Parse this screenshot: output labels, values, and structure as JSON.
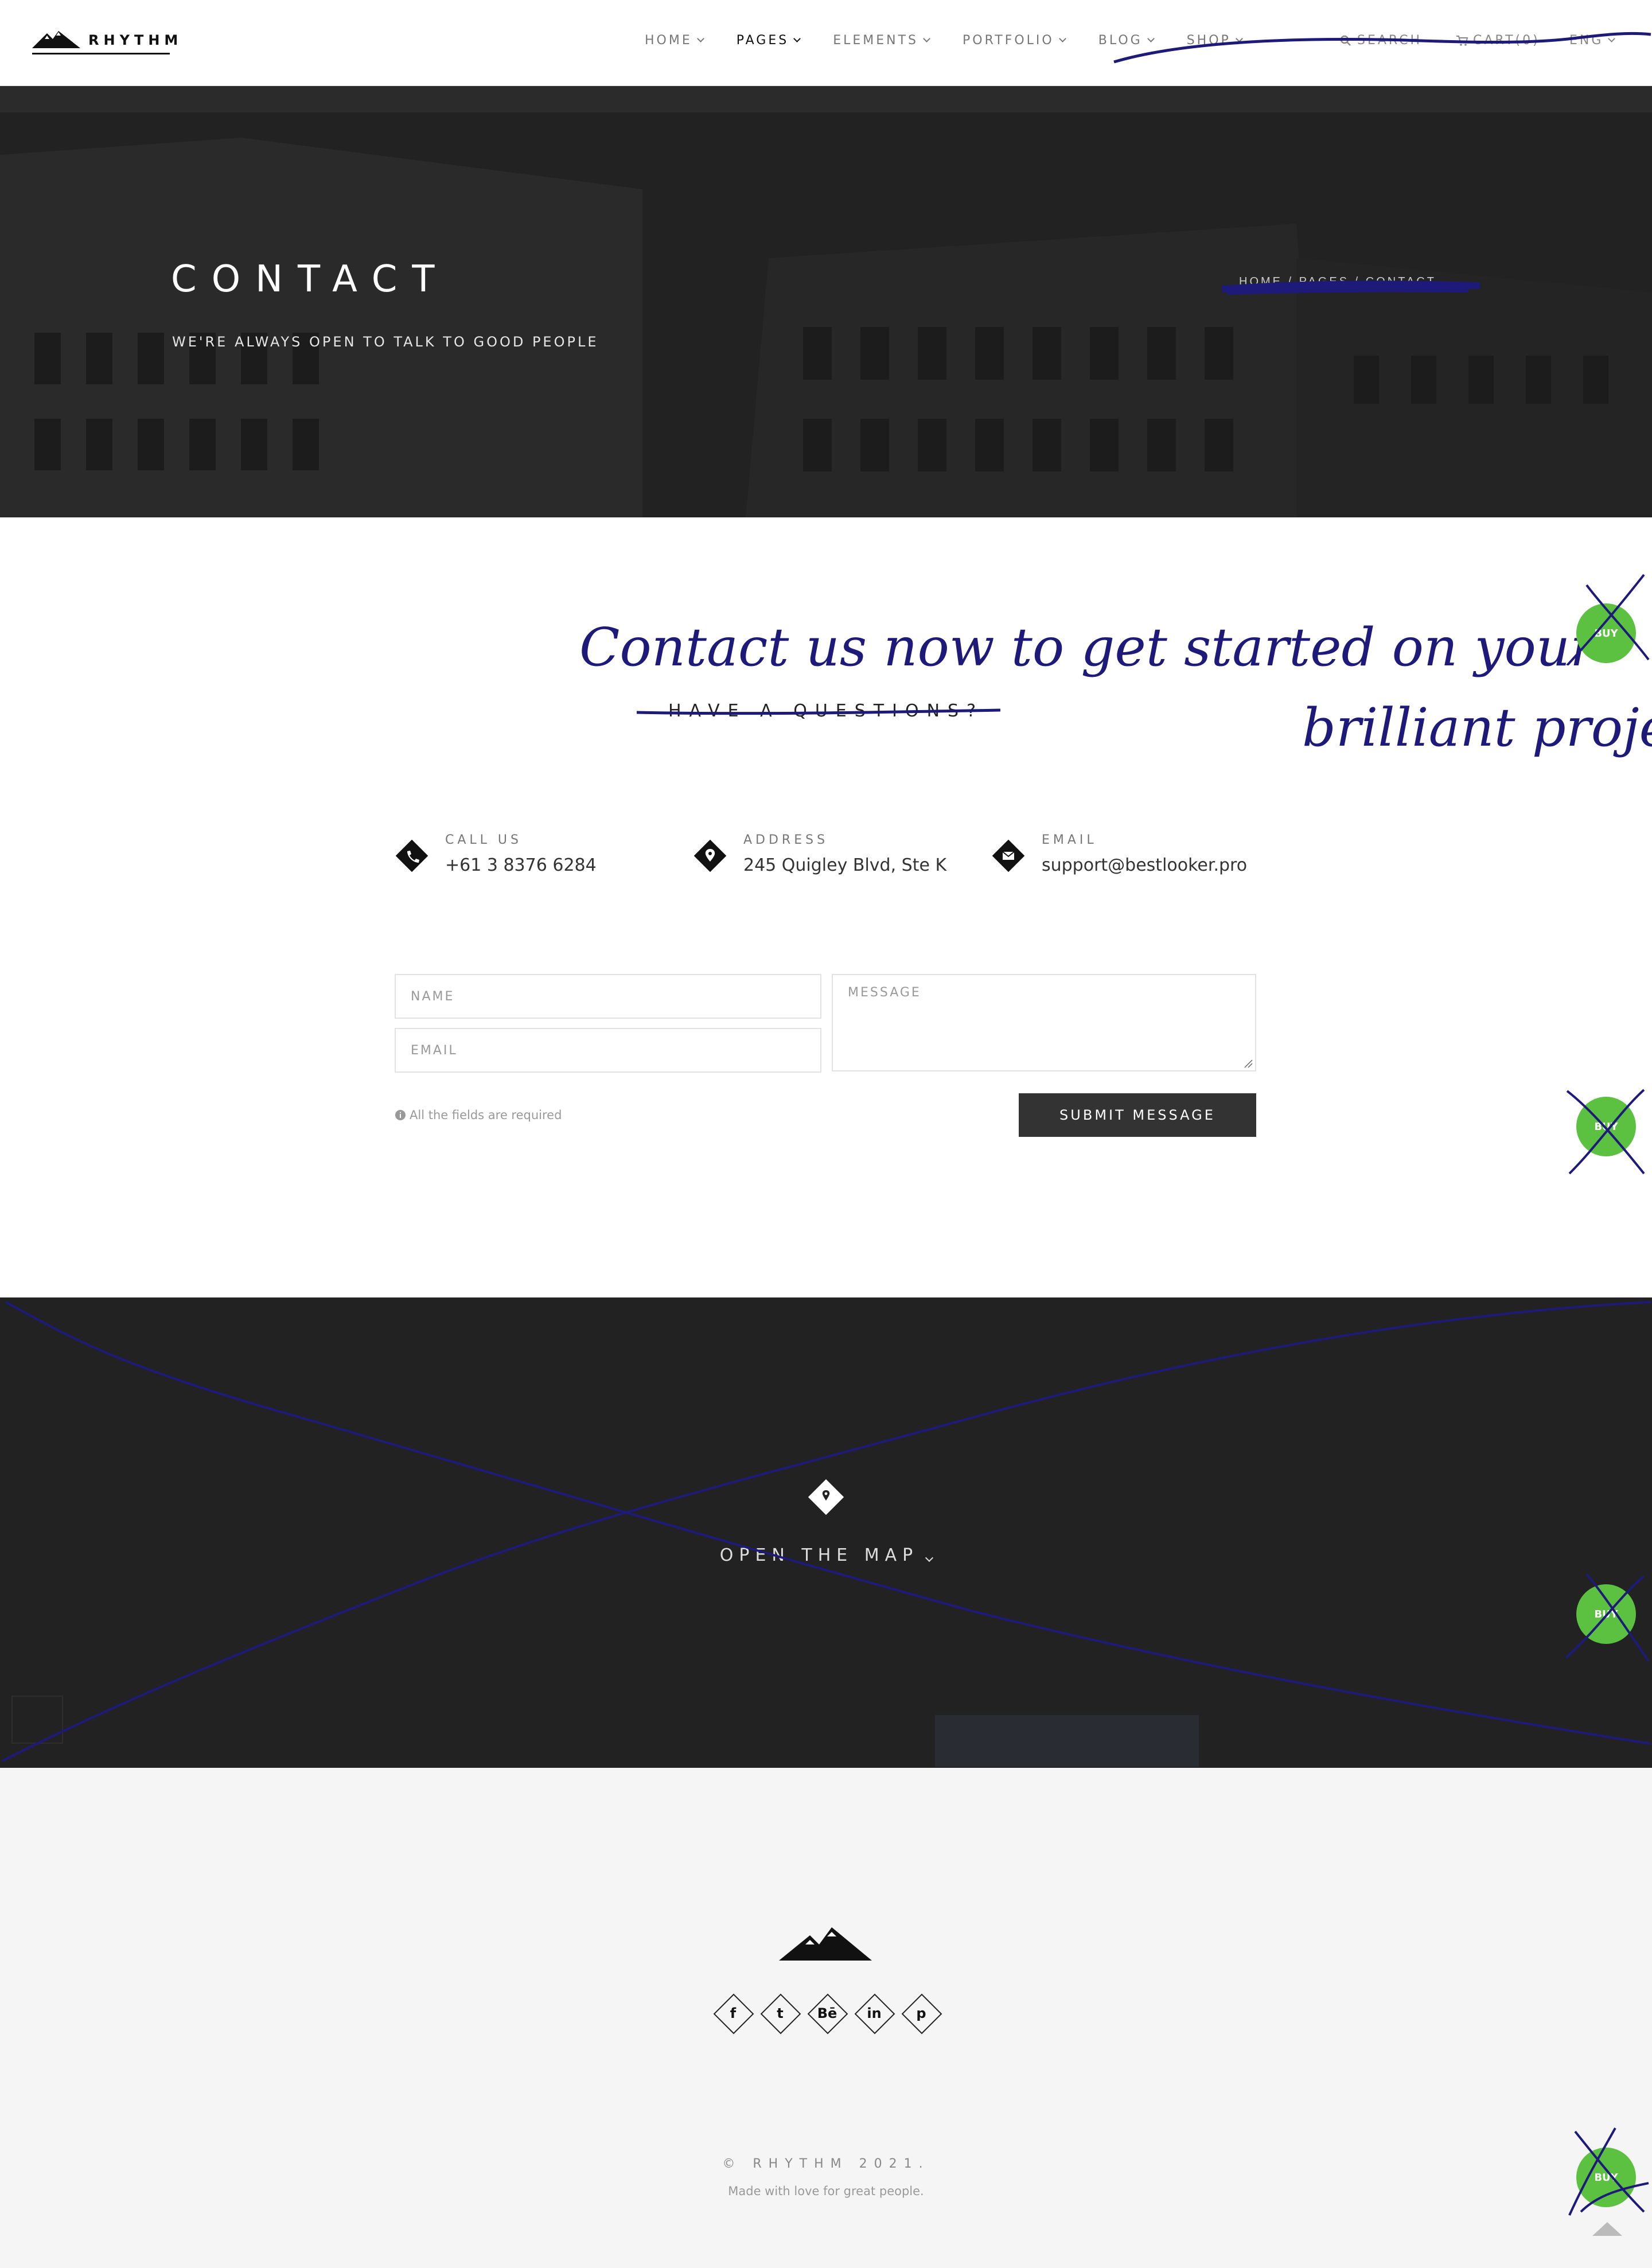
{
  "header": {
    "logo_text": "RHYTHM",
    "nav": [
      {
        "label": "HOME"
      },
      {
        "label": "PAGES"
      },
      {
        "label": "ELEMENTS"
      },
      {
        "label": "PORTFOLIO"
      },
      {
        "label": "BLOG"
      },
      {
        "label": "SHOP"
      }
    ],
    "search_label": "SEARCH",
    "cart_label": "CART(0)",
    "lang_label": "ENG"
  },
  "hero": {
    "title": "CONTACT",
    "subtitle": "WE'RE ALWAYS OPEN TO TALK TO GOOD PEOPLE",
    "breadcrumb": "HOME / PAGES / CONTACT"
  },
  "contact": {
    "section_title": "HAVE A QUESTIONS?",
    "handwritten_note": "Contact us now to get started on your brilliant project!",
    "info": [
      {
        "label": "CALL US",
        "value": "+61 3 8376 6284",
        "icon": "phone-icon"
      },
      {
        "label": "ADDRESS",
        "value": "245 Quigley Blvd, Ste K",
        "icon": "map-pin-icon"
      },
      {
        "label": "EMAIL",
        "value": "support@bestlooker.pro",
        "icon": "envelope-icon"
      }
    ]
  },
  "form": {
    "name_placeholder": "NAME",
    "email_placeholder": "EMAIL",
    "message_placeholder": "MESSAGE",
    "required_note": "All the fields are required",
    "submit_label": "SUBMIT MESSAGE"
  },
  "map": {
    "label": "OPEN THE MAP"
  },
  "footer": {
    "socials": [
      {
        "icon": "facebook-icon",
        "glyph": "f"
      },
      {
        "icon": "twitter-icon",
        "glyph": "t"
      },
      {
        "icon": "behance-icon",
        "glyph": "Bē"
      },
      {
        "icon": "linkedin-icon",
        "glyph": "in"
      },
      {
        "icon": "pinterest-icon",
        "glyph": "p"
      }
    ],
    "copyright": "© RHYTHM 2021.",
    "made_with": "Made with love for great people."
  },
  "buy_badge": {
    "label": "BUY",
    "color": "#5cc040"
  },
  "colors": {
    "annotation_ink": "#1d1a7a",
    "dark_band": "#222222",
    "footer_bg": "#f5f5f5"
  }
}
